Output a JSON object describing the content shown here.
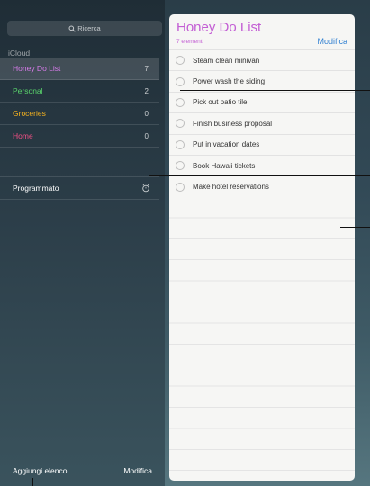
{
  "search": {
    "placeholder": "Ricerca"
  },
  "sidebar": {
    "section_label": "iCloud",
    "lists": [
      {
        "name": "Honey Do List",
        "count": "7",
        "color": "#d57be8",
        "selected": true
      },
      {
        "name": "Personal",
        "count": "2",
        "color": "#59d36b"
      },
      {
        "name": "Groceries",
        "count": "0",
        "color": "#f5b21f"
      },
      {
        "name": "Home",
        "count": "0",
        "color": "#f04f84"
      }
    ],
    "scheduled_label": "Programmato",
    "scheduled_icon": "alarm-clock-icon",
    "footer": {
      "add_list": "Aggiungi elenco",
      "edit": "Modifica"
    }
  },
  "panel": {
    "title": "Honey Do List",
    "subtitle": "7 elementi",
    "edit": "Modifica",
    "accent": "#c35ed4",
    "link_color": "#2f7fd1",
    "tasks": [
      "Steam clean minivan",
      "Power wash the siding",
      "Pick out patio tile",
      "Finish business proposal",
      "Put in vacation dates",
      "Book Hawaii tickets",
      "Make hotel reservations"
    ]
  }
}
